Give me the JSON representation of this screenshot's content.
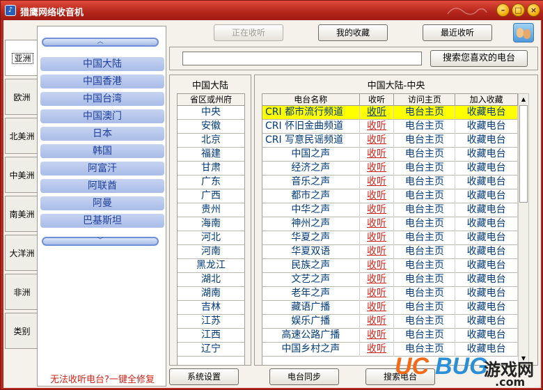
{
  "window": {
    "title": "猎鹰网络收音机",
    "min": "0",
    "max": "1",
    "close": "r"
  },
  "continents": [
    {
      "label": "亚洲",
      "active": true
    },
    {
      "label": "欧洲"
    },
    {
      "label": "北美洲"
    },
    {
      "label": "中美洲"
    },
    {
      "label": "南美洲"
    },
    {
      "label": "大洋洲"
    },
    {
      "label": "非洲"
    },
    {
      "label": "类别"
    }
  ],
  "countries": [
    "中国大陆",
    "中国香港",
    "中国台湾",
    "中国澳门",
    "日本",
    "韩国",
    "阿富汗",
    "阿联酋",
    "阿曼",
    "巴基斯坦"
  ],
  "repair_link": "无法收听电台?一键全修复",
  "top_buttons": {
    "playing": "正在收听",
    "favorites": "我的收藏",
    "recent": "最近收听"
  },
  "search": {
    "placeholder": "",
    "button": "搜索您喜欢的电台"
  },
  "province_panel": {
    "title": "中国大陆",
    "header": "省区或州府",
    "items": [
      "中央",
      "安徽",
      "北京",
      "福建",
      "甘肃",
      "广东",
      "广西",
      "贵州",
      "海南",
      "河北",
      "河南",
      "黑龙江",
      "湖北",
      "湖南",
      "吉林",
      "江苏",
      "江西",
      "辽宁"
    ]
  },
  "station_panel": {
    "title": "中国大陆-中央",
    "headers": {
      "name": "电台名称",
      "listen": "收听",
      "home": "访问主页",
      "fav": "加入收藏"
    },
    "listen_text": "收听",
    "home_text": "电台主页",
    "fav_text": "收藏电台",
    "stations": [
      "CRI 都市流行频道",
      "CRI 怀旧金曲频道",
      "CRI 写意民谣频道",
      "中国之声",
      "经济之声",
      "音乐之声",
      "都市之声",
      "中华之声",
      "神州之声",
      "华夏之声",
      "华夏双语",
      "民族之声",
      "文艺之声",
      "老年之声",
      "藏语广播",
      "娱乐广播",
      "高速公路广播",
      "中国乡村之声"
    ],
    "selected_index": 0
  },
  "bottom_buttons": {
    "settings": "系统设置",
    "sync": "电台同步",
    "search": "搜索电台"
  },
  "watermark": {
    "uc": "UC",
    "bug": "BUG",
    "cn": "游戏网",
    "com": ".com"
  },
  "colors": {
    "title_bar": "#b3241a",
    "selected_row": "#ffff00",
    "listen_link": "#d0241a",
    "country_btn": "#a9bce8"
  }
}
